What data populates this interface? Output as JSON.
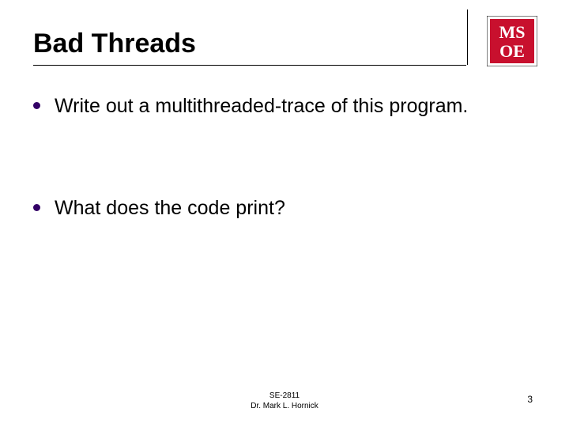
{
  "title": "Bad Threads",
  "logo": {
    "top_text": "MS",
    "bottom_text": "OE",
    "bg": "#c8102e",
    "fg": "#ffffff"
  },
  "bullets": [
    "Write out a multithreaded-trace of this program.",
    "What does the code print?"
  ],
  "footer": {
    "course": "SE-2811",
    "author": "Dr. Mark L. Hornick"
  },
  "page_number": "3"
}
